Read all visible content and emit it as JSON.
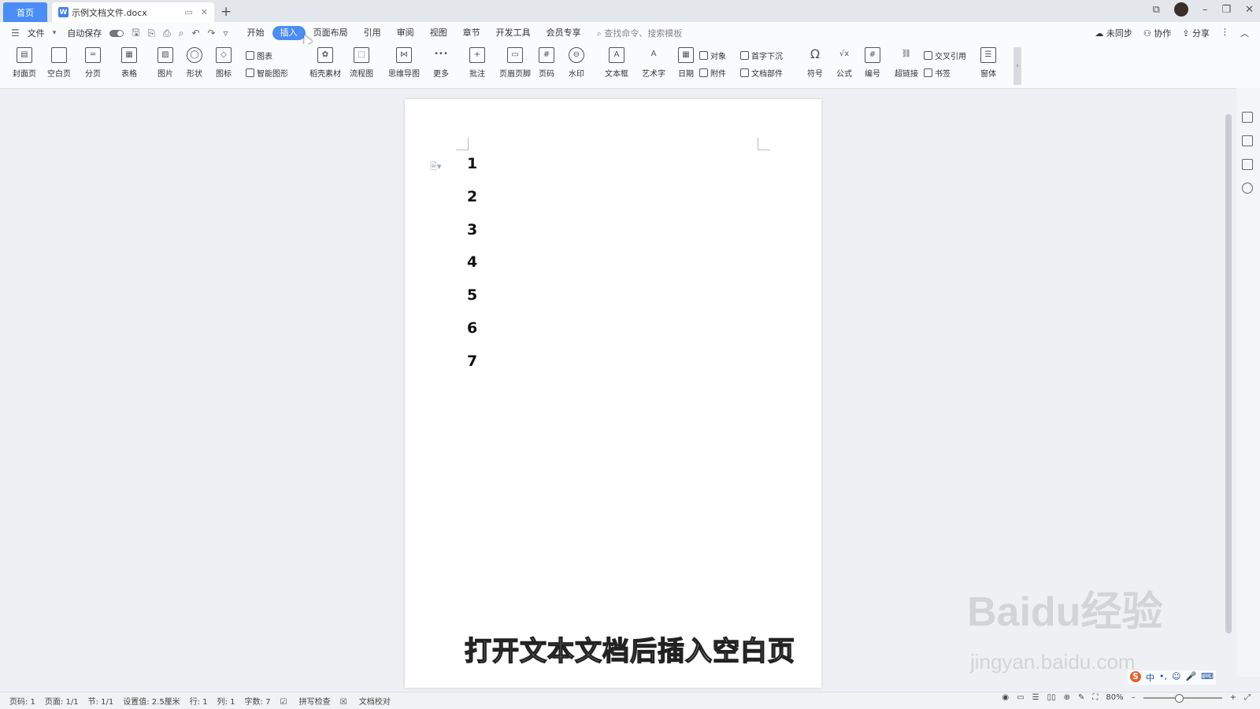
{
  "titlebar": {
    "home_tab": "首页",
    "doc_tab": "示例文档文件.docx",
    "doc_icon": "W",
    "add_tab": "+"
  },
  "menubar": {
    "file": "文件",
    "autosave": "自动保存",
    "tabs": [
      "开始",
      "插入",
      "页面布局",
      "引用",
      "审阅",
      "视图",
      "章节",
      "开发工具",
      "会员专享"
    ],
    "active_tab": "插入",
    "search_placeholder": "查找命令、搜索模板",
    "right": [
      "未同步",
      "协作",
      "分享"
    ]
  },
  "ribbon": {
    "buttons": [
      "封面页",
      "空白页",
      "分页",
      "表格",
      "图片",
      "形状",
      "图标",
      "稻壳素材",
      "流程图",
      "思维导图",
      "更多",
      "批注",
      "页眉页脚",
      "页码",
      "水印",
      "文本框",
      "艺术字",
      "日期",
      "符号",
      "公式",
      "编号",
      "超链接",
      "窗体"
    ],
    "small": [
      "图表",
      "智能图形",
      "对象",
      "附件",
      "首字下沉",
      "文档部件",
      "交叉引用",
      "书签"
    ]
  },
  "document": {
    "lines": [
      "1",
      "2",
      "3",
      "4",
      "5",
      "6",
      "7"
    ]
  },
  "overlay": {
    "subtitle": "打开文本文档后插入空白页",
    "watermark": "Baidu经验",
    "watermark_url": "jingyan.baidu.com"
  },
  "statusbar": {
    "items": [
      "页码: 1",
      "页面: 1/1",
      "节: 1/1",
      "设置值: 2.5厘米",
      "行: 1",
      "列: 1",
      "字数: 7",
      "拼写检查",
      "文档校对"
    ],
    "zoom": "80%"
  },
  "ime": [
    "中",
    "•,",
    "☺",
    "🎤",
    "⌨"
  ]
}
